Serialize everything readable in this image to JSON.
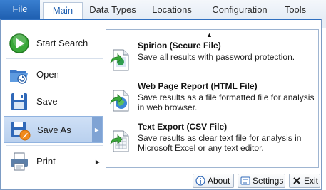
{
  "ribbon": {
    "file_tab": "File",
    "tabs": [
      {
        "label": "Main"
      },
      {
        "label": "Data Types"
      },
      {
        "label": "Locations"
      },
      {
        "label": "Configuration"
      },
      {
        "label": "Tools"
      }
    ],
    "active_tab": "Main"
  },
  "file_menu": {
    "items": [
      {
        "label": "Start Search",
        "icon": "play-icon"
      },
      {
        "label": "Open",
        "icon": "open-folder-icon"
      },
      {
        "label": "Save",
        "icon": "floppy-disk-icon"
      },
      {
        "label": "Save As",
        "icon": "save-as-icon",
        "selected": true,
        "has_submenu": true
      },
      {
        "label": "Print",
        "icon": "printer-icon",
        "has_submenu": true
      }
    ],
    "submenu": {
      "scroll_up_glyph": "▲",
      "options": [
        {
          "title": "Spirion (Secure File)",
          "description": "Save all results with password protection.",
          "icon": "secure-file-icon"
        },
        {
          "title": "Web Page Report (HTML File)",
          "description": "Save results as a file formatted file for analysis in web browser.",
          "icon": "html-file-icon"
        },
        {
          "title": "Text Export (CSV File)",
          "description": "Save results as clear text file for analysis in Microsoft Excel or any text editor.",
          "icon": "csv-file-icon"
        }
      ]
    },
    "buttons": {
      "about": "About",
      "settings": "Settings",
      "exit": "Exit"
    }
  },
  "colors": {
    "file_tab": "#1f5fb0",
    "selected_item": "#b9d0ee",
    "accent_green": "#3aa83a"
  }
}
